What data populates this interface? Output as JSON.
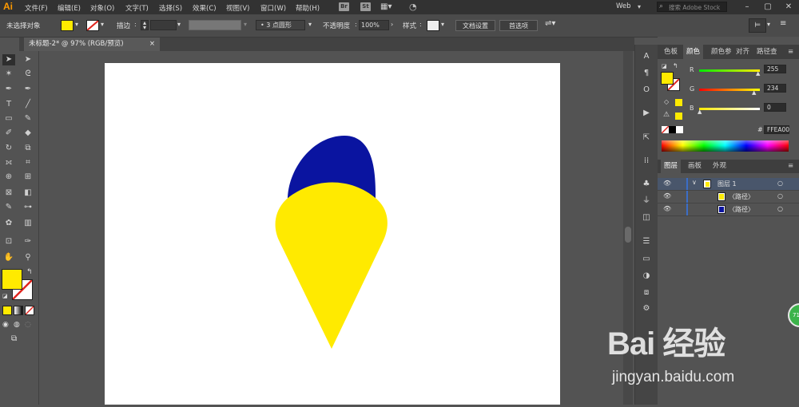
{
  "app": {
    "logo": "Ai"
  },
  "menu": [
    "文件(F)",
    "编辑(E)",
    "对象(O)",
    "文字(T)",
    "选择(S)",
    "效果(C)",
    "视图(V)",
    "窗口(W)",
    "帮助(H)"
  ],
  "menubar_icons": [
    "Br",
    "St"
  ],
  "workspace": "Web",
  "search": {
    "placeholder": "搜索 Adobe Stock"
  },
  "controlbar": {
    "selection_label": "未选择对象",
    "stroke_label": "描边",
    "brush_label": "3 点圆形",
    "opacity_label": "不透明度",
    "opacity_value": "100%",
    "style_label": "样式",
    "doc_setup_button": "文档设置",
    "preferences_button": "首选项"
  },
  "document": {
    "tab_title": "未标题-2* @ 97% (RGB/预览)",
    "close_glyph": "×"
  },
  "colors": {
    "fill": "#FFEA00",
    "navy": "#0A14A0",
    "accent": "#ff9a00",
    "badge": "#3cb34a"
  },
  "color_panel": {
    "tabs": [
      "色板",
      "颜色",
      "颜色参",
      "对齐",
      "路径查"
    ],
    "active_tab": "颜色",
    "r_label": "R",
    "r_value": "255",
    "g_label": "G",
    "g_value": "234",
    "b_label": "B",
    "b_value": "0",
    "hex_label": "#",
    "hex_value": "FFEA00"
  },
  "layers_panel": {
    "tabs": [
      "图层",
      "画板",
      "外观"
    ],
    "active_tab": "图层",
    "rows": [
      {
        "name": "图层 1",
        "type": "layer"
      },
      {
        "name": "〈路径〉",
        "type": "path"
      },
      {
        "name": "〈路径〉",
        "type": "path"
      }
    ]
  },
  "badge": {
    "text": "71"
  },
  "watermark": {
    "logo": "Bai 经验",
    "url": "jingyan.baidu.com"
  }
}
